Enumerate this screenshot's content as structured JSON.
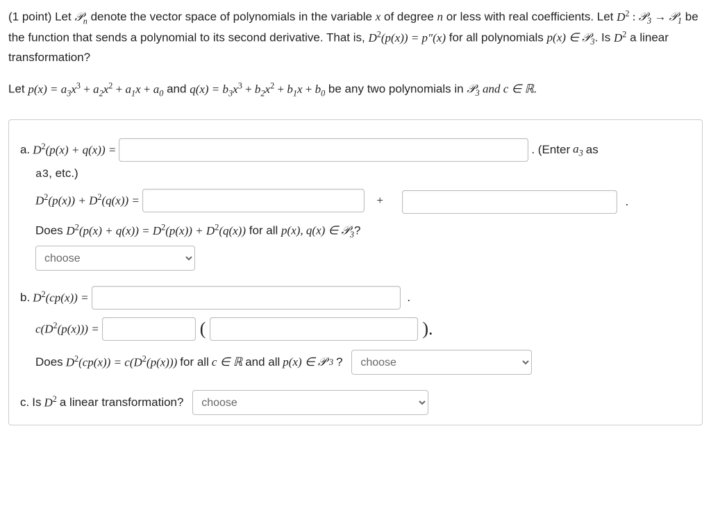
{
  "header": {
    "points": "(1 point)",
    "p1_text": " Let ",
    "Pn": "𝒫",
    "p1_cont": " denote the vector space of polynomials in the variable ",
    "var_x": "x",
    "p1_cont2": " of degree ",
    "var_n": "n",
    "p1_cont3": " or less with real coefficients. Let ",
    "D2": "D",
    "map_sep": " : ",
    "P3": "𝒫",
    "arrow": " → ",
    "P1": "𝒫",
    "p1_cont4": " be the function that sends a polynomial to its second derivative. That is, ",
    "eq_lhs": "D",
    "eq_open": "(p(x)) = p″(x)",
    "p1_cont5": " for all polynomials ",
    "px_in": "p(x) ∈ ",
    "p1_cont6": ". Is ",
    "p1_cont7": " a linear transformation?"
  },
  "para2": {
    "let": "Let ",
    "px_expand": "p(x) = a",
    "plus": " + ",
    "x_text": "x",
    "and_text": " and ",
    "qx_expand": "q(x) = b",
    "tail": " be any two polynomials in ",
    "inR": " and c ∈ ℝ."
  },
  "partA": {
    "label_a": "a. ",
    "lhs1_pre": "D",
    "lhs1_mid": "(p(x) + q(x)) = ",
    "hint_pre": ". (Enter ",
    "hint_sym": "a",
    "hint_as": " as ",
    "hint_mono": "a3",
    "hint_post": ", etc.)",
    "lhs2_mid": "(p(x)) + D",
    "lhs2_end": "(q(x)) = ",
    "plus_txt": "+",
    "period": ".",
    "does_pre": "Does ",
    "does_mid": "(p(x) + q(x)) = D",
    "does_mid2": "(p(x)) + D",
    "does_mid3": "(q(x))",
    "forall": " for all ",
    "pxqx": "p(x), q(x) ∈ ",
    "qmark": "?"
  },
  "partB": {
    "label_b": "b. ",
    "lhs_b1": "(cp(x)) = ",
    "lhs_b2_pre": "c(D",
    "lhs_b2_mid": "(p(x))) = ",
    "paren_l": "(",
    "paren_r": ").",
    "does_pre": "Does ",
    "mid1": "(cp(x)) = c(D",
    "mid2": "(p(x)))",
    "forall": " for all ",
    "c_in_R": "c ∈ ℝ",
    "and_all": " and all ",
    "px_in": "p(x) ∈ ",
    "qmark": "?"
  },
  "partC": {
    "label_c": "c. ",
    "question": "Is ",
    "tail": " a linear transformation?"
  },
  "selects": {
    "choose": "choose"
  },
  "sym": {
    "sup2": "2",
    "sup3": "3",
    "sub0": "0",
    "sub1": "1",
    "sub2": "2",
    "sub3": "3",
    "subn": "n",
    "P": "𝒫",
    "R": "ℝ"
  }
}
